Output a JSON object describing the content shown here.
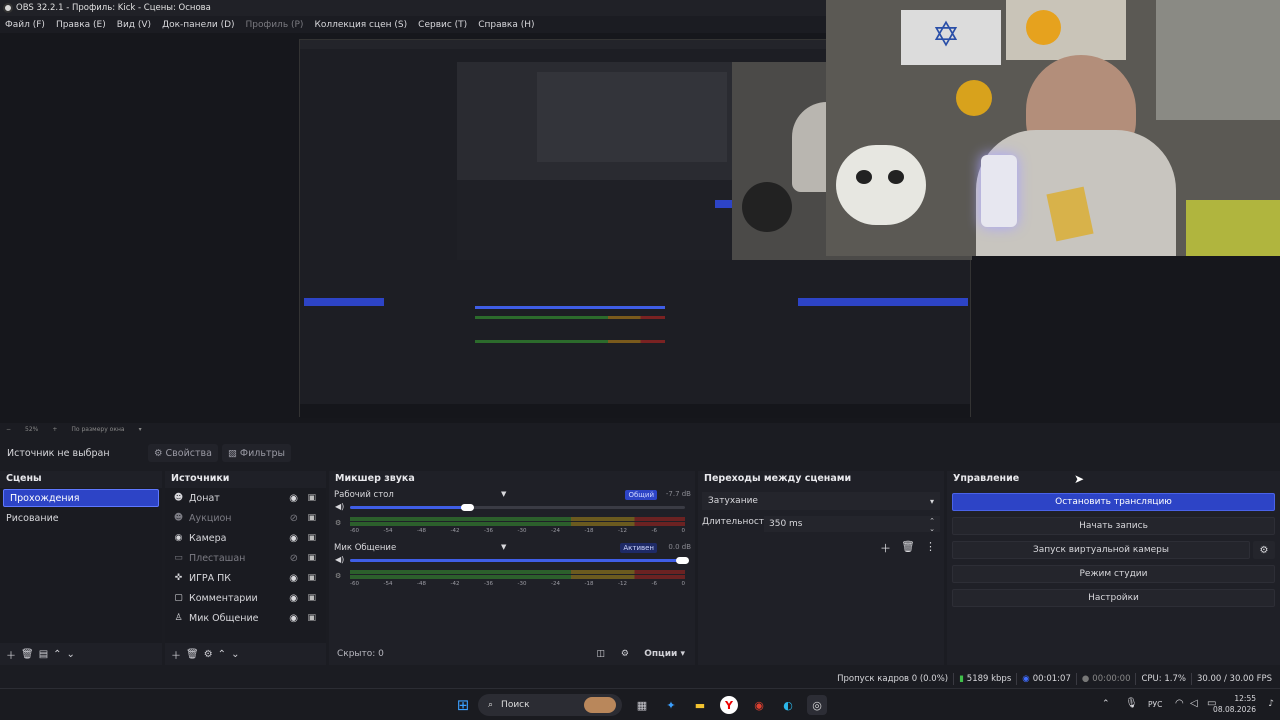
{
  "window": {
    "title": "OBS 32.2.1 - Профиль: Kick - Сцены: Основа"
  },
  "menu": [
    {
      "label": "Файл (F)",
      "disabled": false
    },
    {
      "label": "Правка (E)",
      "disabled": false
    },
    {
      "label": "Вид (V)",
      "disabled": false
    },
    {
      "label": "Док-панели (D)",
      "disabled": false
    },
    {
      "label": "Профиль (P)",
      "disabled": true
    },
    {
      "label": "Коллекция сцен (S)",
      "disabled": false
    },
    {
      "label": "Сервис (T)",
      "disabled": false
    },
    {
      "label": "Справка (H)",
      "disabled": false
    }
  ],
  "zoom": {
    "value": "52%",
    "mode": "По размеру окна"
  },
  "propbar": {
    "no_source": "Источник не выбран",
    "properties": "Свойства",
    "filters": "Фильтры"
  },
  "scenes": {
    "title": "Сцены",
    "items": [
      "Прохождения",
      "Рисование"
    ],
    "selected": 0
  },
  "sources": {
    "title": "Источники",
    "items": [
      {
        "name": "Донат",
        "icon": "person-icon",
        "visible": true
      },
      {
        "name": "Аукцион",
        "icon": "person-icon",
        "visible": false
      },
      {
        "name": "Камера",
        "icon": "camera-icon",
        "visible": true
      },
      {
        "name": "Плесташан",
        "icon": "window-icon",
        "visible": false
      },
      {
        "name": "ИГРА ПК",
        "icon": "gamepad-icon",
        "visible": true
      },
      {
        "name": "Комментарии",
        "icon": "monitor-icon",
        "visible": true
      },
      {
        "name": "Мик Общение",
        "icon": "microphone-icon",
        "visible": true
      }
    ]
  },
  "mixer": {
    "title": "Микшер звука",
    "channels": [
      {
        "name": "Рабочий стол",
        "badge": "Общий",
        "db": "-7.7 dB",
        "volume": 0.35,
        "badge_color": "#2d44c6"
      },
      {
        "name": "Мик Общение",
        "badge": "Активен",
        "db": "0.0 dB",
        "volume": 0.99,
        "badge_color": "#1e2a66"
      }
    ],
    "ticks": [
      "-60",
      "-54",
      "-48",
      "-42",
      "-36",
      "-30",
      "-24",
      "-18",
      "-12",
      "-6",
      "0"
    ],
    "hidden": "Скрыто: 0",
    "options": "Опции"
  },
  "transitions": {
    "title": "Переходы между сценами",
    "type": "Затухание",
    "duration_label": "Длительность",
    "duration_value": "350 ms"
  },
  "controls": {
    "title": "Управление",
    "stop_stream": "Остановить трансляцию",
    "start_record": "Начать запись",
    "virtual_cam": "Запуск виртуальной камеры",
    "studio_mode": "Режим студии",
    "settings": "Настройки"
  },
  "status": {
    "dropped": "Пропуск кадров 0 (0.0%)",
    "bitrate": "5189 kbps",
    "stream_time": "00:01:07",
    "rec_time": "00:00:00",
    "cpu": "CPU: 1.7%",
    "fps": "30.00 / 30.00 FPS"
  },
  "taskbar": {
    "search": "Поиск",
    "lang": "РУС",
    "time": "12:55",
    "date": "08.08.2026"
  },
  "colors": {
    "accent": "#2d44c6",
    "bg": "#1b1c22"
  }
}
